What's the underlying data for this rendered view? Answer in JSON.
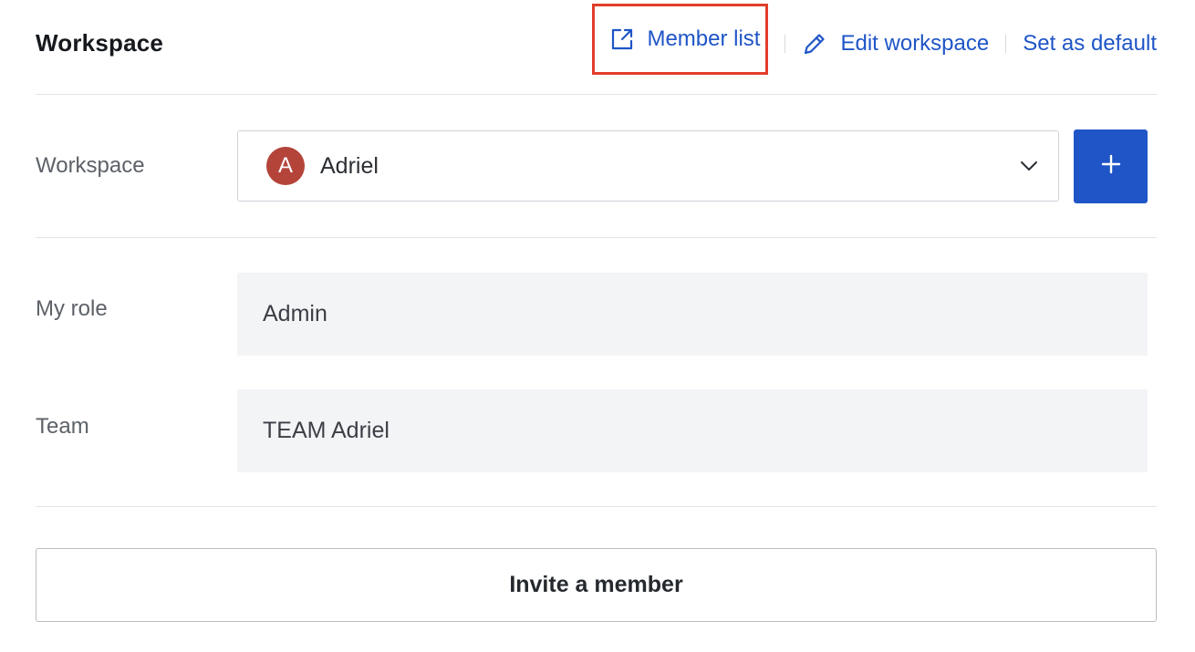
{
  "header": {
    "title": "Workspace",
    "actions": {
      "member_list": {
        "label": "Member list",
        "icon": "external-link-icon"
      },
      "edit_workspace": {
        "label": "Edit workspace",
        "icon": "pencil-icon"
      },
      "set_default": {
        "label": "Set as default"
      }
    }
  },
  "workspace_row": {
    "label": "Workspace",
    "selected": {
      "avatar_letter": "A",
      "name": "Adriel"
    },
    "dropdown_icon": "chevron-down-icon",
    "add_icon": "plus-icon"
  },
  "role_row": {
    "label": "My role",
    "value": "Admin"
  },
  "team_row": {
    "label": "Team",
    "value": "TEAM Adriel"
  },
  "invite_button": {
    "label": "Invite a member"
  },
  "colors": {
    "accent": "#1f55c7",
    "highlight": "#e23d2b",
    "avatar": "#b4443a"
  }
}
